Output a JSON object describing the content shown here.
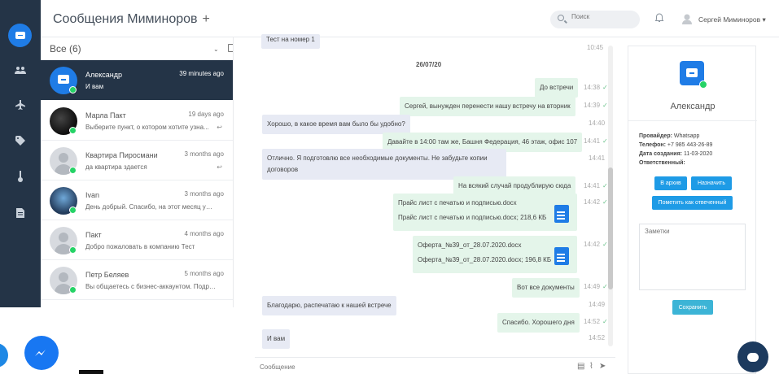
{
  "header": {
    "title": "Сообщения Миминоров",
    "plus": "+",
    "search_placeholder": "Поиск",
    "user_name": "Сергей Миминоров ▾"
  },
  "sidebar": {
    "icons": [
      "chat-icon",
      "users-icon",
      "airplane-icon",
      "tag-icon",
      "thermometer-icon",
      "document-icon"
    ]
  },
  "convlist": {
    "filter": "Все (6)",
    "items": [
      {
        "name": "Александр",
        "time": "39 minutes ago",
        "preview": "И вам",
        "active": true
      },
      {
        "name": "Марла Пакт",
        "time": "19 days ago",
        "preview": "Выберите пункт, о котором хотите узна...",
        "reply": "↩"
      },
      {
        "name": "Квартира Пиросмани",
        "time": "3 months ago",
        "preview": "да квартира здается",
        "reply": "↩"
      },
      {
        "name": "Ivan",
        "time": "3 months ago",
        "preview": "День добрый. Спасибо, на этот месяц уже ..."
      },
      {
        "name": "Пакт",
        "time": "4 months ago",
        "preview": "Добро пожаловать в компанию Тест"
      },
      {
        "name": "Петр Беляев",
        "time": "5 months ago",
        "preview": "Вы общаетесь с бизнес-аккаунтом. Подро..."
      }
    ]
  },
  "chat": {
    "top_partial": "Тест на номер 1",
    "top_partial_time": "10:45",
    "date": "26/07/20",
    "messages": [
      {
        "text": "До встречи",
        "time": "14:38",
        "dir": "out"
      },
      {
        "text": "Сергей, вынужден перенести нашу встречу на вторник",
        "time": "14:39",
        "dir": "out"
      },
      {
        "text": "Хорошо, в какое время вам было бы удобно?",
        "time": "14:40",
        "dir": "in"
      },
      {
        "text": "Давайте в 14:00 там же, Башня Федерация, 46 этаж, офис 107",
        "time": "14:41",
        "dir": "out"
      },
      {
        "text": "Отлично. Я подготовлю все необходимые документы. Не забудьте копии",
        "text2": "договоров",
        "time": "14:41",
        "dir": "in"
      },
      {
        "text": "На всякий случай продублирую сюда",
        "time": "14:41",
        "dir": "out"
      },
      {
        "text": "Прайс лист с печатью и подписью.docx",
        "text2": "Прайс лист с печатью и подписью.docx; 218,6 КБ",
        "time": "14:42",
        "dir": "out"
      },
      {
        "text": "Оферта_№39_от_28.07.2020.docx",
        "text2": "Оферта_№39_от_28.07.2020.docx; 196,8 КБ",
        "time": "14:42",
        "dir": "out"
      },
      {
        "text": "Вот все документы",
        "time": "14:49",
        "dir": "out"
      },
      {
        "text": "Благодарю, распечатаю к нашей встрече",
        "time": "14:49",
        "dir": "in"
      },
      {
        "text": "Спасибо. Хорошего дня",
        "time": "14:52",
        "dir": "out"
      },
      {
        "text": "И вам",
        "time": "14:52",
        "dir": "in"
      }
    ],
    "composer_placeholder": "Сообщение"
  },
  "details": {
    "name": "Александр",
    "provider_label": "Провайдер:",
    "provider_value": "Whatsapp",
    "phone_label": "Телефон:",
    "phone_value": "+7 985 443-26-89",
    "created_label": "Дата создания:",
    "created_value": "11-03-2020",
    "responsible_label": "Ответственный:",
    "archive_button": "В архив",
    "assign_button": "Назначить",
    "mark_button": "Пометить как отвеченный",
    "notes_placeholder": "Заметки",
    "save_button": "Сохранить"
  },
  "colors": {
    "sidebar": "#243447",
    "accent": "#1f7ce6",
    "whatsapp": "#25d366",
    "bubble_in": "#e7eaf4",
    "bubble_out": "#e4f5ea"
  }
}
